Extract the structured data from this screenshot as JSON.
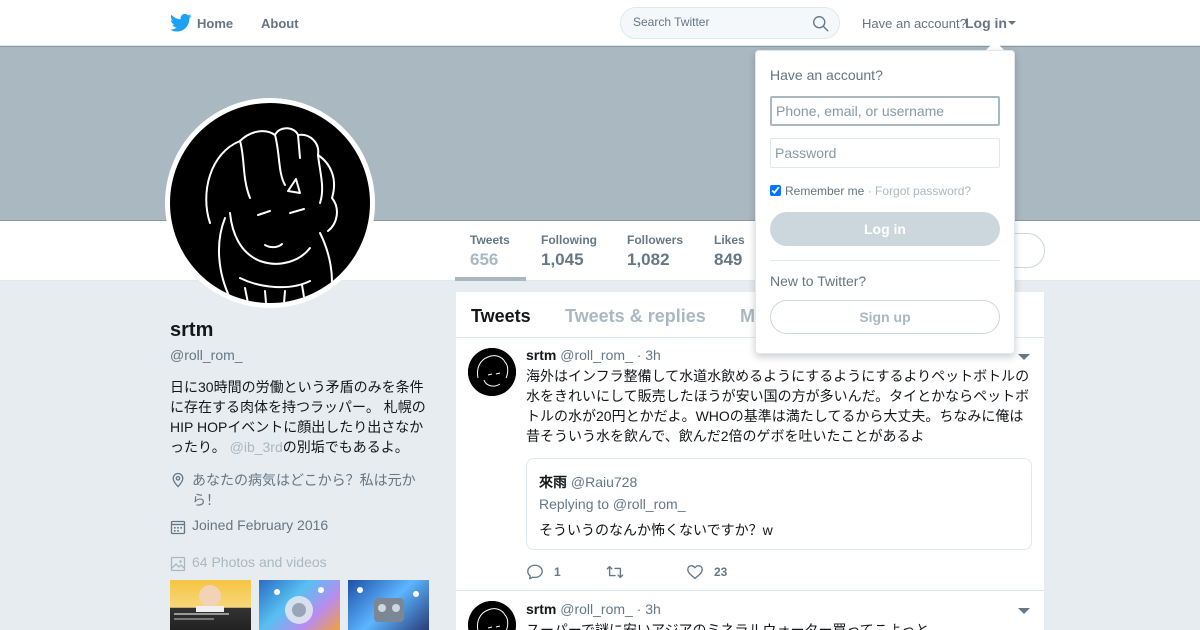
{
  "nav": {
    "home_label": "Home",
    "about_label": "About",
    "search_placeholder": "Search Twitter",
    "have_account": "Have an account?",
    "login_label": "Log in",
    "brand_color": "#1da1f2"
  },
  "profile": {
    "name": "srtm",
    "handle": "@roll_rom_",
    "bio_main": "日に30時間の労働という矛盾のみを条件に存在する肉体を持つラッパー。 札幌のHIP HOPイベントに顔出したり出さなかったり。",
    "bio_mention": "@ib_3rd",
    "bio_tail": "の別垢でもあるよ。",
    "location": "あなたの病気はどこから？私は元から！",
    "joined": "Joined February 2016",
    "photos": "64 Photos and videos"
  },
  "stats": [
    {
      "label": "Tweets",
      "value": "656"
    },
    {
      "label": "Following",
      "value": "1,045"
    },
    {
      "label": "Followers",
      "value": "1,082"
    },
    {
      "label": "Likes",
      "value": "849"
    }
  ],
  "tabs": [
    "Tweets",
    "Tweets & replies",
    "M"
  ],
  "tweets": [
    {
      "name": "srtm",
      "handle": "@roll_rom_",
      "time": "· 3h",
      "text": "海外はインフラ整備して水道水飲めるようにするようにするよりペットボトルの水をきれいにして販売したほうが安い国の方が多いんだ。タイとかならペットボトルの水が20円とかだよ。WHOの基準は満たしてるから大丈夫。ちなみに俺は昔そういう水を飲んで、飲んだ2倍のゲボを吐いたことがあるよ",
      "quote": {
        "name": "來雨",
        "handle": "@Raiu728",
        "replying": "Replying to @roll_rom_",
        "text": "そういうのなんか怖くないですか？w"
      },
      "replies": "1",
      "likes": "23"
    },
    {
      "name": "srtm",
      "handle": "@roll_rom_",
      "time": "· 3h",
      "text": "スーパーで謎に安いアジアのミネラルウォーター買ってこよっと"
    }
  ],
  "login_dropdown": {
    "title": "Have an account?",
    "username_placeholder": "Phone, email, or username",
    "password_placeholder": "Password",
    "remember_label": "Remember me",
    "forgot_label": "· Forgot password?",
    "login_button": "Log in",
    "new_to": "New to Twitter?",
    "signup_button": "Sign up"
  }
}
